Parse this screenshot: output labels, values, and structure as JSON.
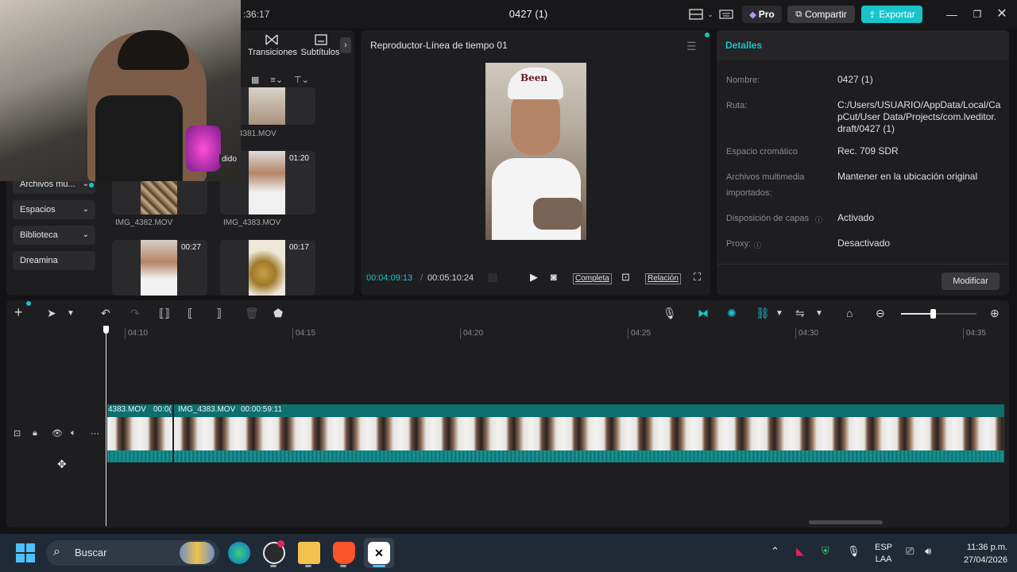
{
  "titlebar": {
    "time_fragment": ":36:17",
    "project_name": "0427 (1)",
    "pro_label": "Pro",
    "share_label": "Compartir",
    "export_label": "Exportar",
    "accent": "#18c4c9"
  },
  "media_panel": {
    "tabs": [
      {
        "label": "Transiciones",
        "icon": "transition-icon"
      },
      {
        "label": "Subtítulos",
        "icon": "subtitle-icon"
      }
    ],
    "sidebar_items": [
      {
        "label": "Archivos mu..."
      },
      {
        "label": "Espacios"
      },
      {
        "label": "Biblioteca"
      },
      {
        "label": "Dreamina"
      }
    ],
    "webcam_tag": "dido",
    "clips": [
      {
        "name": "IMG_4381.MOV",
        "label": "4381.MOV",
        "duration": ""
      },
      {
        "name": "IMG_4382.MOV",
        "label": "IMG_4382.MOV",
        "duration": ""
      },
      {
        "name": "IMG_4383.MOV",
        "label": "IMG_4383.MOV",
        "duration": "01:20"
      },
      {
        "name": "clip-4",
        "label": "",
        "duration": "00:27"
      },
      {
        "name": "clip-5",
        "label": "",
        "duration": "00:17"
      }
    ]
  },
  "player": {
    "title": "Reproductor-Línea de tiempo 01",
    "overlay_cap_text": "Been",
    "current_time": "00:04:09:13",
    "separator": "/",
    "total_time": "00:05:10:24",
    "full_label": "Completa",
    "ratio_label": "Relación"
  },
  "details": {
    "title": "Detalles",
    "rows": [
      {
        "label": "Nombre:",
        "value": "0427 (1)"
      },
      {
        "label": "Ruta:",
        "value": "C:/Users/USUARIO/AppData/Local/CapCut/User Data/Projects/com.lveditor.draft/0427 (1)"
      },
      {
        "label": "Espacio cromático",
        "value": "Rec. 709 SDR"
      },
      {
        "label": "Archivos multimedia importados:",
        "value": "Mantener en la ubicación original"
      },
      {
        "label": "Disposición de capas",
        "value": "Activado"
      },
      {
        "label": "Proxy:",
        "value": "Desactivado"
      }
    ],
    "modify_label": "Modificar"
  },
  "timeline": {
    "ruler": [
      "04:10",
      "04:15",
      "04:20",
      "04:25",
      "04:30",
      "04:35"
    ],
    "clip_labels": [
      {
        "text": "4383.MOV"
      },
      {
        "text": "00:0("
      },
      {
        "text": "IMG_4383.MOV"
      },
      {
        "text": "00:00:59:11"
      }
    ],
    "zoom_level": 0.42
  },
  "taskbar": {
    "search_placeholder": "Buscar",
    "lang_line1": "ESP",
    "lang_line2": "LAA",
    "time": "11:36 p.m.",
    "date": "27/04/2026",
    "accent": "#4cc2ff"
  }
}
